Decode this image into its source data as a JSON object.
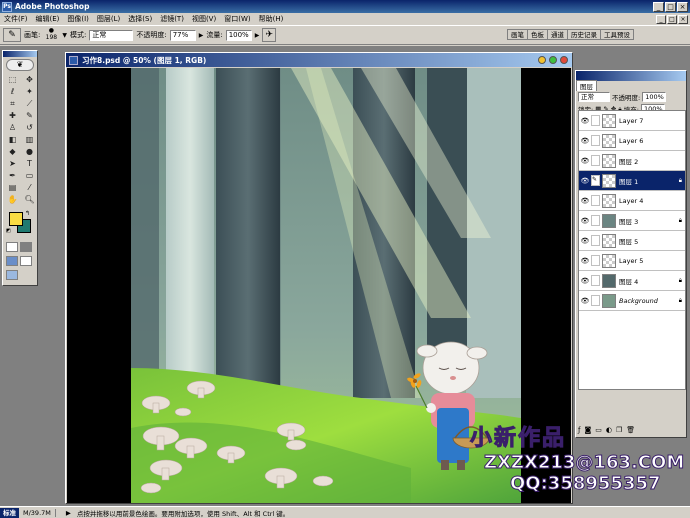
{
  "app": {
    "title": "Adobe Photoshop",
    "window_buttons": [
      "_",
      "□",
      "×"
    ]
  },
  "menu": [
    "文件(F)",
    "编辑(E)",
    "图像(I)",
    "图层(L)",
    "选择(S)",
    "滤镜(T)",
    "视图(V)",
    "窗口(W)",
    "帮助(H)"
  ],
  "options": {
    "brush_label": "画笔:",
    "brush_size": "198",
    "mode_label": "模式:",
    "mode_value": "正常",
    "opacity_label": "不透明度:",
    "opacity_value": "77%",
    "flow_label": "流量:",
    "flow_value": "100%"
  },
  "palette_well": [
    "画笔",
    "色板",
    "通道",
    "历史记录",
    "工具预设"
  ],
  "document": {
    "title": "习作8.psd @ 50% (图层 1, RGB)"
  },
  "layers_panel": {
    "tab": "图层",
    "blend_mode": "正常",
    "opacity_label": "不透明度:",
    "opacity_value": "100%",
    "lock_label": "锁定:",
    "fill_label": "填充:",
    "fill_value": "100%",
    "layers": [
      {
        "name": "Layer 7",
        "active": false
      },
      {
        "name": "Layer 6",
        "active": false
      },
      {
        "name": "图层 2",
        "active": false
      },
      {
        "name": "图层 1",
        "active": true
      },
      {
        "name": "Layer 4",
        "active": false
      },
      {
        "name": "图层 3",
        "active": false
      },
      {
        "name": "图层 5",
        "active": false
      },
      {
        "name": "Layer 5",
        "active": false
      },
      {
        "name": "图层 4",
        "active": false
      },
      {
        "name": "Background",
        "active": false
      }
    ]
  },
  "status": {
    "start": "标准",
    "file_size": "M/39.7M",
    "hint": "点按并拖移以用前景色绘画。要用附加选项，使用 Shift、Alt 和 Ctrl 键。"
  },
  "watermark": {
    "line1": "小新作品",
    "line2": "ZXZX213@163.COM",
    "line3": "QQ:358955357"
  },
  "colors": {
    "foreground": "#f9dc43",
    "background": "#1f7a70",
    "active_layer": "#0a246a"
  }
}
